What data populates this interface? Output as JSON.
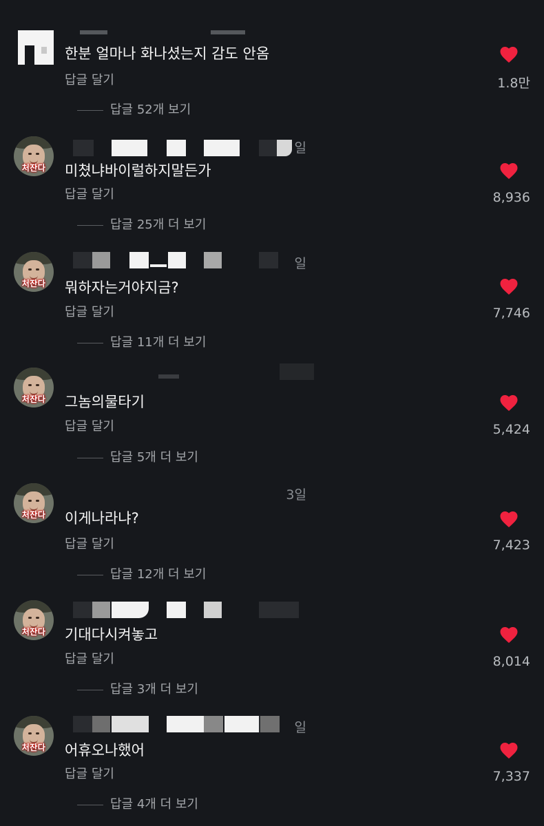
{
  "reply_label": "답글 달기",
  "heart_color": "#f0223f",
  "comments": [
    {
      "text": "한분 얼마나 화나셨는지 감도 안옴",
      "date": "",
      "likes": "1.8만",
      "replies": "답글 52개 보기"
    },
    {
      "text": "미쳤냐바이럴하지말든가",
      "date": "일",
      "likes": "8,936",
      "replies": "답글 25개 더 보기",
      "avatar_tag": "처잔다"
    },
    {
      "text": "뭐하자는거야지금?",
      "date": "일",
      "likes": "7,746",
      "replies": "답글 11개 더 보기",
      "avatar_tag": "처잔다"
    },
    {
      "text": "그놈의물타기",
      "date": "",
      "likes": "5,424",
      "replies": "답글 5개 더 보기",
      "avatar_tag": "처잔다"
    },
    {
      "text": "이게나라냐?",
      "date": "3일",
      "likes": "7,423",
      "replies": "답글 12개 더 보기",
      "avatar_tag": "처잔다"
    },
    {
      "text": "기대다시켜놓고",
      "date": "",
      "likes": "8,014",
      "replies": "답글 3개 더 보기",
      "avatar_tag": "처잔다"
    },
    {
      "text": "어휴오나했어",
      "date": "일",
      "likes": "7,337",
      "replies": "답글 4개 더 보기",
      "avatar_tag": "처잔다"
    }
  ]
}
